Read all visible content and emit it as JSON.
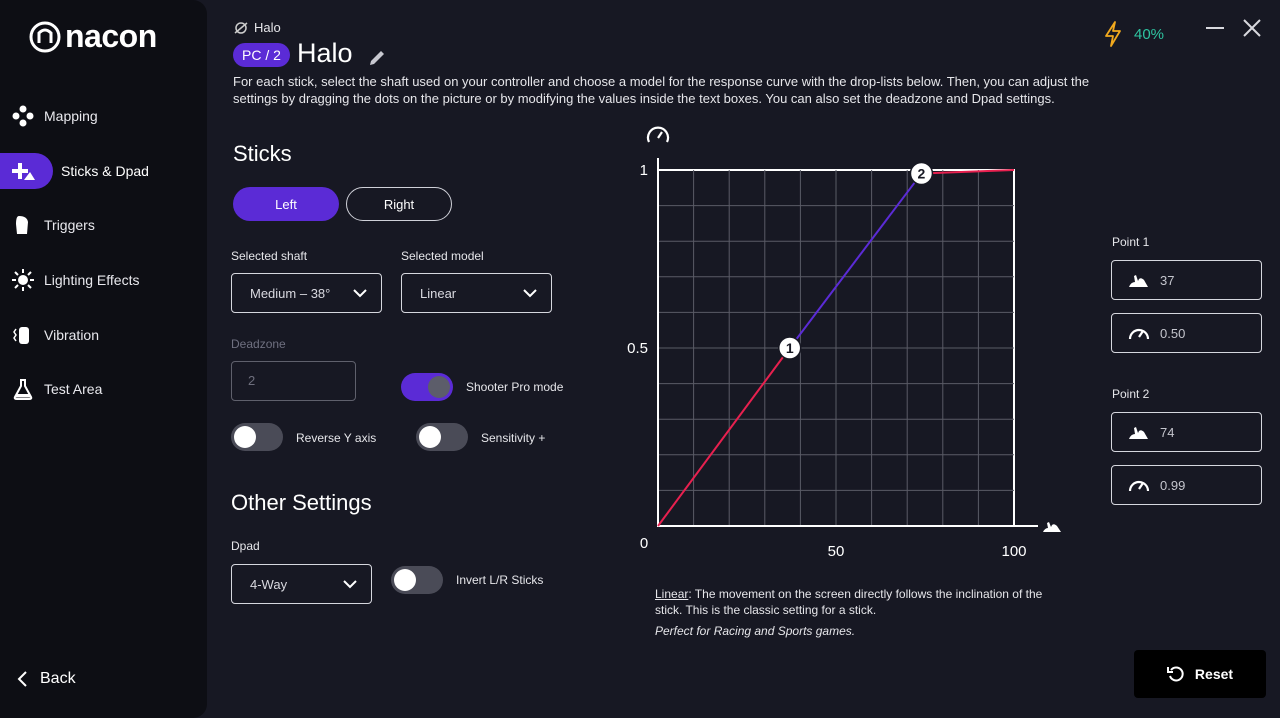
{
  "app": {
    "logo_text": "nacon"
  },
  "sidebar": {
    "items": [
      {
        "label": "Mapping",
        "icon": "gamepad-icon"
      },
      {
        "label": "Sticks & Dpad",
        "icon": "stick-icon",
        "active": true
      },
      {
        "label": "Triggers",
        "icon": "trigger-icon"
      },
      {
        "label": "Lighting Effects",
        "icon": "light-icon"
      },
      {
        "label": "Vibration",
        "icon": "vibration-icon"
      },
      {
        "label": "Test Area",
        "icon": "flask-icon"
      }
    ],
    "back_label": "Back"
  },
  "header": {
    "game": "Halo",
    "platform_pill": "PC / 2",
    "profile_name": "Halo",
    "description": "For each stick, select the shaft used on your controller and choose a model for the response curve with the drop-lists below. Then, you can adjust the settings by dragging the dots on the picture or by modifying the values inside the text boxes. You can also set the deadzone and Dpad settings.",
    "battery": "40%"
  },
  "sticks": {
    "title": "Sticks",
    "left_label": "Left",
    "right_label": "Right",
    "shaft_label": "Selected shaft",
    "shaft_value": "Medium – 38°",
    "model_label": "Selected model",
    "model_value": "Linear",
    "deadzone_label": "Deadzone",
    "deadzone_value": "2",
    "shooter_label": "Shooter Pro mode",
    "reverse_label": "Reverse Y axis",
    "sensitivity_label": "Sensitivity +"
  },
  "other": {
    "title": "Other Settings",
    "dpad_label": "Dpad",
    "dpad_value": "4-Way",
    "invert_label": "Invert L/R Sticks"
  },
  "chart_data": {
    "type": "line",
    "x_ticks": [
      "0",
      "50",
      "100"
    ],
    "y_ticks": [
      "1",
      "0.5"
    ],
    "points": [
      {
        "label": "1",
        "x": 37,
        "y": 0.5
      },
      {
        "label": "2",
        "x": 74,
        "y": 0.99
      }
    ],
    "curve": [
      [
        0,
        0
      ],
      [
        37,
        0.5
      ],
      [
        74,
        0.99
      ],
      [
        100,
        1
      ]
    ],
    "xlim": [
      0,
      100
    ],
    "ylim": [
      0,
      1
    ],
    "grid": true,
    "colors": {
      "segment1": "#e8204f",
      "segment2": "#5b2bd6",
      "segment3": "#e8204f"
    }
  },
  "points": {
    "p1_label": "Point 1",
    "p1_x": "37",
    "p1_y": "0.50",
    "p2_label": "Point 2",
    "p2_x": "74",
    "p2_y": "0.99"
  },
  "curve_info": {
    "model": "Linear",
    "text": ": The movement on the screen directly follows the inclination of the stick. This is the classic setting for a stick.",
    "note": "Perfect for Racing and Sports games."
  },
  "reset_label": "Reset"
}
